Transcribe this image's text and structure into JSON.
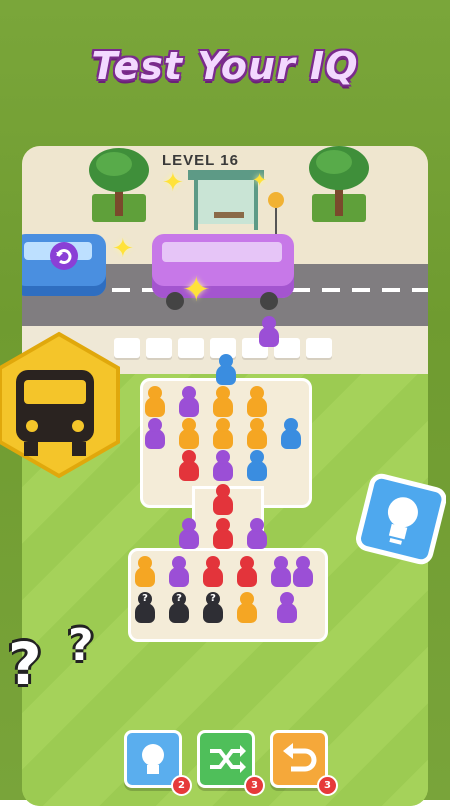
{
  "headline": "Test Your IQ",
  "level_label": "LEVEL 16",
  "colors": {
    "purple": "#9b4fd6",
    "orange": "#f5a623",
    "blue": "#3a8de0",
    "red": "#e3343b",
    "black": "#2e2e34",
    "accent": "#7a2b8c"
  },
  "bottom_buttons": [
    {
      "name": "hint",
      "icon": "lightbulb-icon",
      "count": "2"
    },
    {
      "name": "shuffle",
      "icon": "shuffle-icon",
      "count": "3"
    },
    {
      "name": "undo",
      "icon": "undo-icon",
      "count": "3"
    }
  ],
  "mystery_mark": "?"
}
